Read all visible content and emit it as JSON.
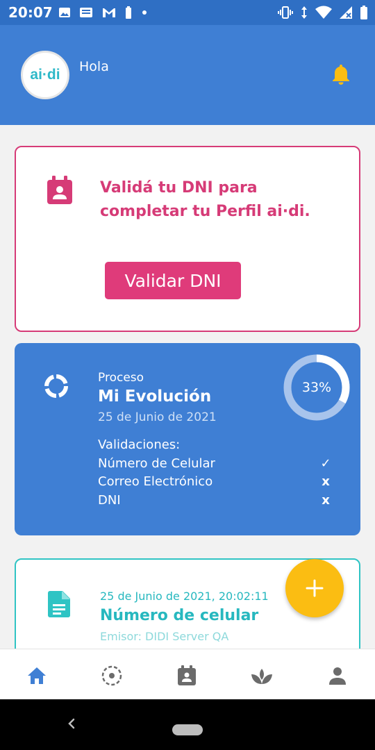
{
  "status_bar": {
    "time": "20:07",
    "left_icons": [
      "image-icon",
      "message-icon",
      "gmail-icon",
      "battery-small-icon",
      "dot-icon"
    ],
    "right_icons": [
      "vibrate-icon",
      "data-arrows-icon",
      "wifi-icon",
      "signal-icon",
      "battery-icon"
    ]
  },
  "header": {
    "logo": "ai·di",
    "greeting": "Hola",
    "bell_icon": "bell-icon",
    "colors": {
      "background": "#3f7fd4",
      "bell": "#fbbd12"
    }
  },
  "validate_card": {
    "icon": "calendar-user-icon",
    "message": "Validá tu DNI para completar tu Perfil ai·di.",
    "button_label": "Validar DNI",
    "accent": "#d63b77"
  },
  "progress_card": {
    "icon": "progress-circle-icon",
    "label": "Proceso",
    "title": "Mi Evolución",
    "date": "25 de Junio de 2021",
    "progress_percent": 33,
    "progress_text": "33%",
    "validations_heading": "Validaciones:",
    "validations": [
      {
        "name": "Número de Celular",
        "mark": "✓"
      },
      {
        "name": "Correo Electrónico",
        "mark": "x"
      },
      {
        "name": "DNI",
        "mark": "x"
      }
    ]
  },
  "credential_card": {
    "icon": "document-icon",
    "date": "25 de Junio de 2021, 20:02:11",
    "title": "Número de celular",
    "issuer": "Emisor: DIDI Server QA",
    "accent": "#27b8bf"
  },
  "fab": {
    "icon": "plus-icon",
    "color": "#fbbd12"
  },
  "bottom_nav": {
    "items": [
      {
        "icon": "home-icon",
        "active": true
      },
      {
        "icon": "dashed-circle-icon",
        "active": false
      },
      {
        "icon": "id-card-icon",
        "active": false
      },
      {
        "icon": "lotus-icon",
        "active": false
      },
      {
        "icon": "person-icon",
        "active": false
      }
    ],
    "active_color": "#3f7fd4",
    "inactive_color": "#6b6b6b"
  },
  "system_nav": {
    "back_icon": "back-chevron-icon",
    "home_icon": "home-pill-icon"
  }
}
